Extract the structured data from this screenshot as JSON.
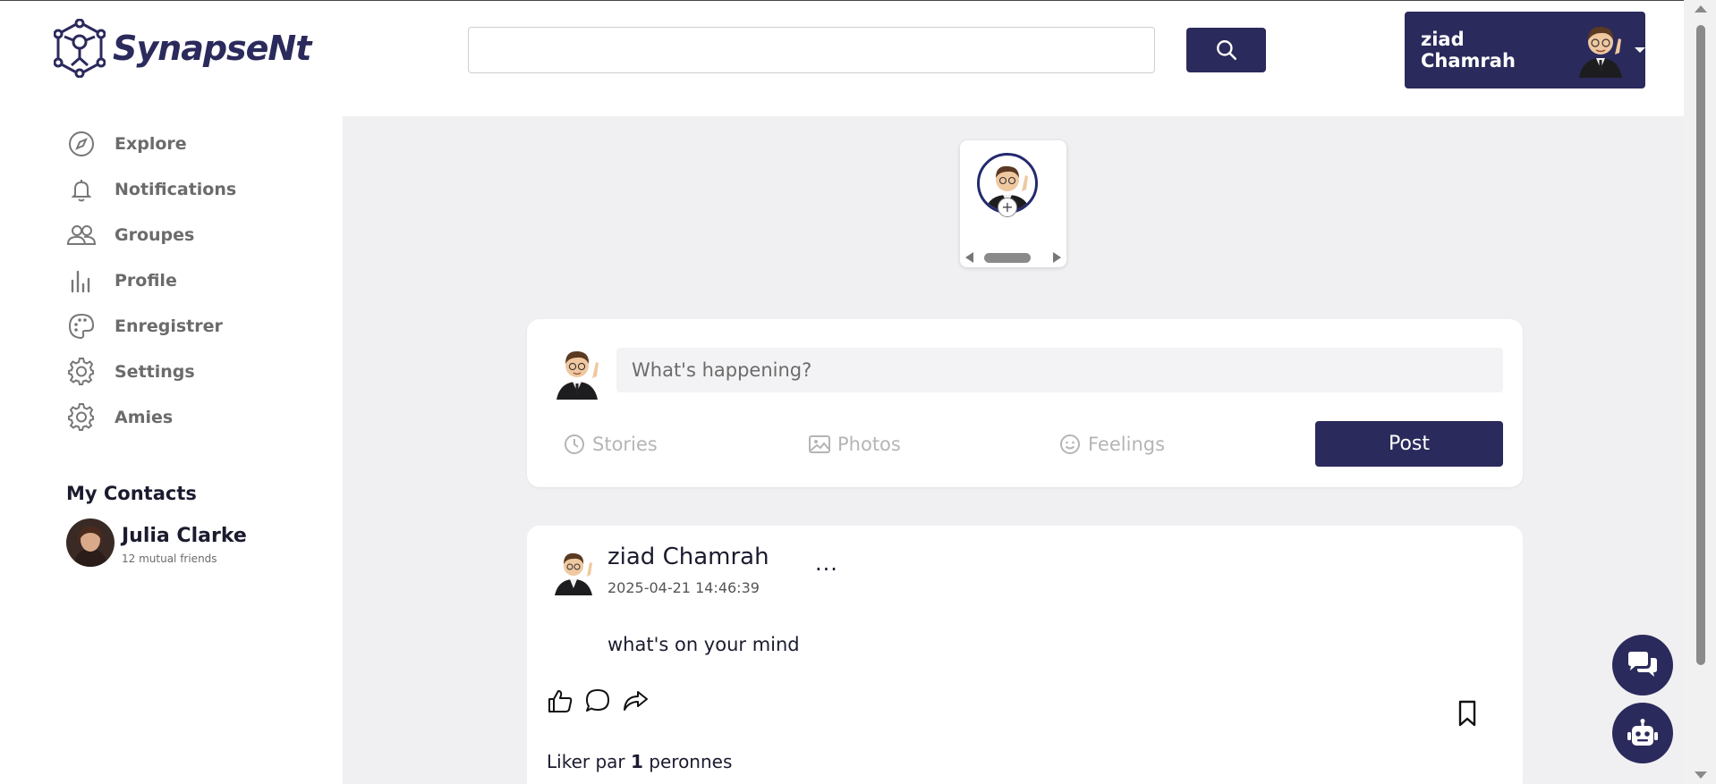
{
  "header": {
    "logo_text": "SynapseNt",
    "search": {
      "value": "",
      "placeholder": ""
    },
    "user_name": "ziad Chamrah"
  },
  "sidebar": {
    "items": [
      {
        "label": "Explore",
        "icon": "compass-icon"
      },
      {
        "label": "Notifications",
        "icon": "bell-icon"
      },
      {
        "label": "Groupes",
        "icon": "users-icon"
      },
      {
        "label": "Profile",
        "icon": "bar-chart-icon"
      },
      {
        "label": "Enregistrer",
        "icon": "palette-icon"
      },
      {
        "label": "Settings",
        "icon": "gear-icon"
      },
      {
        "label": "Amies",
        "icon": "gear-icon"
      }
    ],
    "contacts_title": "My Contacts",
    "contacts": [
      {
        "name": "Julia Clarke",
        "subtitle": "12 mutual friends"
      }
    ]
  },
  "composer": {
    "placeholder": "What's happening?",
    "actions": [
      {
        "label": "Stories",
        "icon": "clock-icon"
      },
      {
        "label": "Photos",
        "icon": "image-icon"
      },
      {
        "label": "Feelings",
        "icon": "smile-icon"
      }
    ],
    "post_label": "Post"
  },
  "post": {
    "author": "ziad Chamrah",
    "timestamp": "2025-04-21 14:46:39",
    "more_label": "...",
    "content": "what's on your mind",
    "likes_prefix": "Liker par",
    "likes_count": "1",
    "likes_suffix": "peronnes"
  },
  "colors": {
    "brand": "#2b2a5c",
    "feed_background": "#f0f0f2",
    "muted_text": "#6b6b6b"
  }
}
